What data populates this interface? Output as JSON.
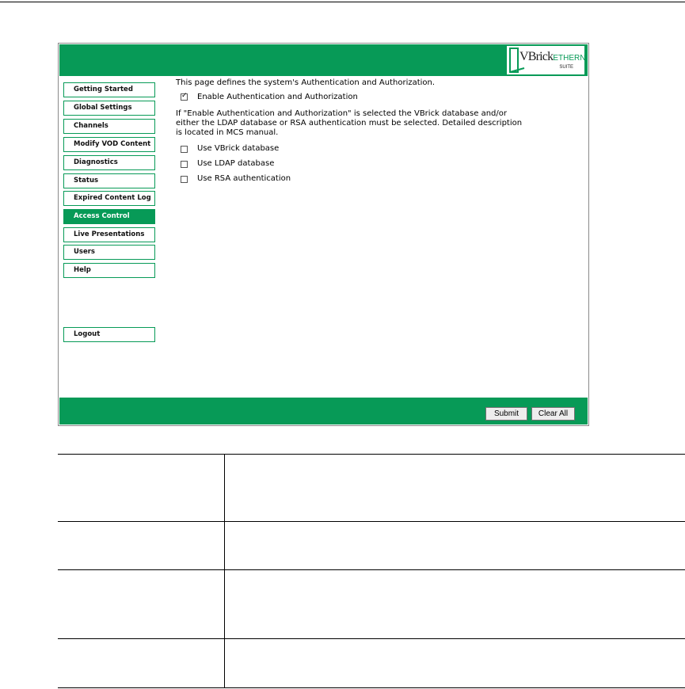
{
  "app": {
    "logo_brand": "VBrick",
    "logo_product": "ETHERNETV",
    "logo_suite": "SUITE"
  },
  "sidebar": {
    "items": [
      {
        "label": "Getting Started",
        "active": false
      },
      {
        "label": "Global Settings",
        "active": false
      },
      {
        "label": "Channels",
        "active": false
      },
      {
        "label": "Modify VOD Content",
        "active": false
      },
      {
        "label": "Diagnostics",
        "active": false
      },
      {
        "label": "Status",
        "active": false
      },
      {
        "label": "Expired Content Log",
        "active": false
      },
      {
        "label": "Access Control",
        "active": true
      },
      {
        "label": "Live Presentations",
        "active": false
      },
      {
        "label": "Users",
        "active": false
      },
      {
        "label": "Help",
        "active": false
      }
    ],
    "logout_label": "Logout"
  },
  "main": {
    "intro": "This page defines the system's Authentication and Authorization.",
    "enable_label": "Enable Authentication and Authorization",
    "enable_checked": true,
    "note_lines": [
      "If \"Enable Authentication and Authorization\" is selected the VBrick database and/or",
      "either the LDAP database or RSA authentication must be selected. Detailed description",
      "is located in MCS manual."
    ],
    "options": [
      {
        "label": "Use VBrick database",
        "checked": false
      },
      {
        "label": "Use LDAP database",
        "checked": false
      },
      {
        "label": "Use RSA authentication",
        "checked": false
      }
    ]
  },
  "footer": {
    "submit_label": "Submit",
    "clear_label": "Clear All"
  },
  "colors": {
    "brand_green": "#079a57"
  }
}
